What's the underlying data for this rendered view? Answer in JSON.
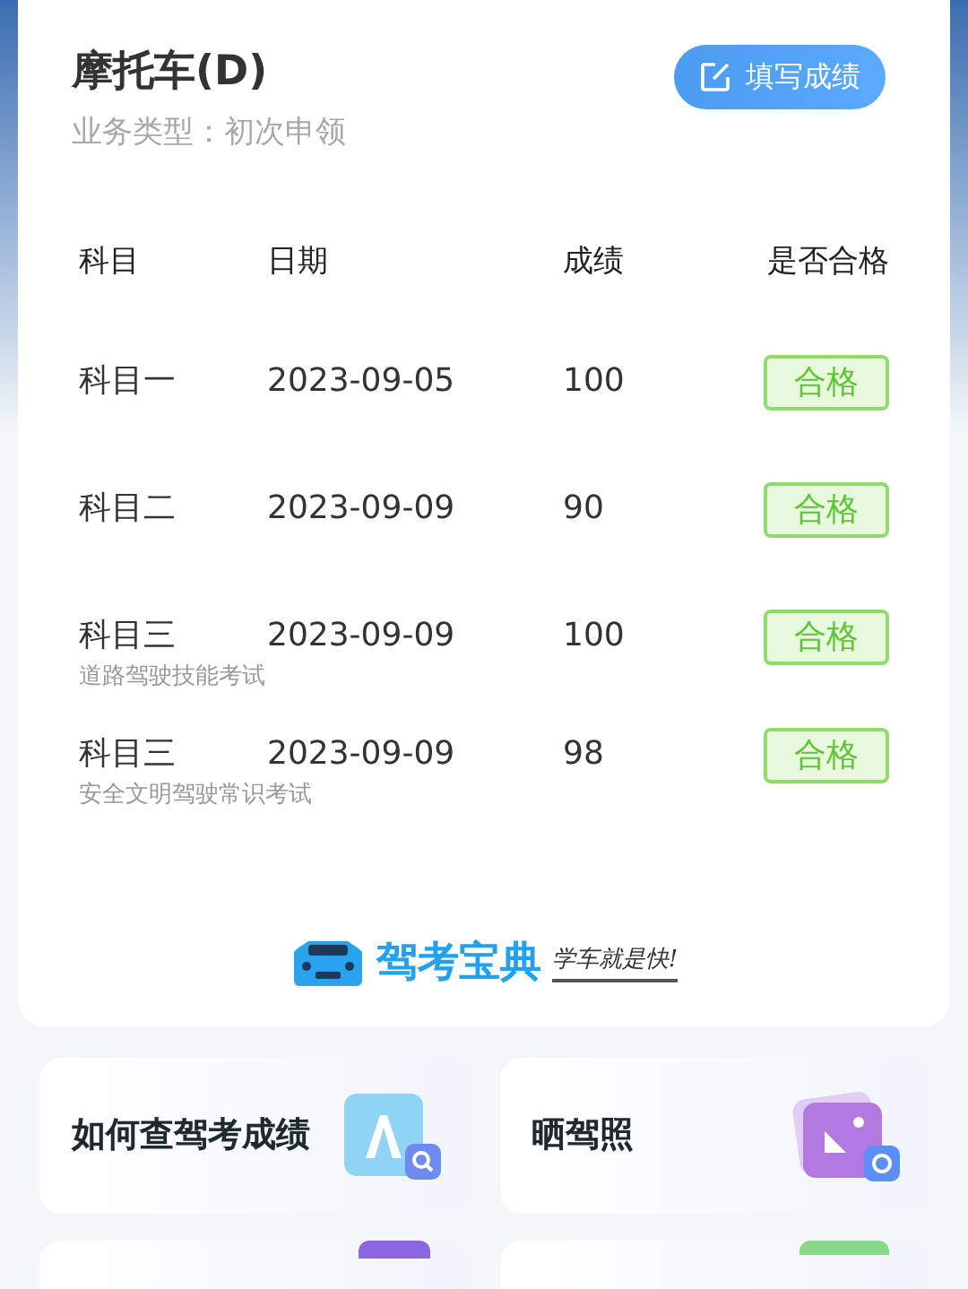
{
  "header": {
    "title": "摩托车(D)",
    "subtitle": "业务类型：初次申领",
    "button": "填写成绩"
  },
  "table": {
    "columns": [
      "科目",
      "日期",
      "成绩",
      "是否合格"
    ],
    "rows": [
      {
        "subject": "科目一",
        "date": "2023-09-05",
        "score": "100",
        "result": "合格",
        "passed": true
      },
      {
        "subject": "科目二",
        "date": "2023-09-09",
        "score": "90",
        "result": "合格",
        "passed": true
      },
      {
        "subject": "科目三",
        "note": "道路驾驶技能考试",
        "date": "2023-09-09",
        "score": "100",
        "result": "合格",
        "passed": true
      },
      {
        "subject": "科目三",
        "note": "安全文明驾驶常识考试",
        "date": "2023-09-09",
        "score": "98",
        "result": "合格",
        "passed": true
      }
    ]
  },
  "logo": {
    "name": "驾考宝典",
    "slogan": "学车就是快!"
  },
  "tiles": [
    {
      "label": "如何查驾考成绩",
      "kind": "search"
    },
    {
      "label": "晒驾照",
      "kind": "photo"
    },
    {
      "kind": "violet"
    },
    {
      "kind": "green"
    }
  ]
}
